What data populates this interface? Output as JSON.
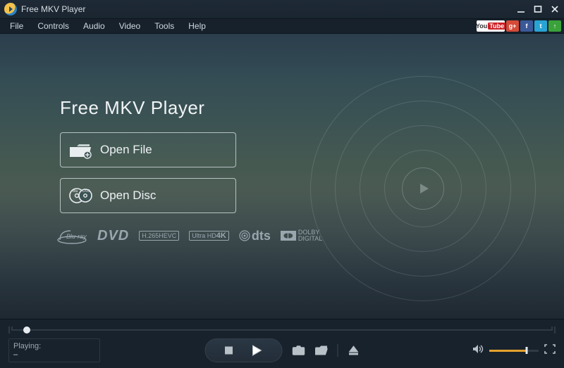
{
  "app": {
    "title": "Free MKV Player"
  },
  "menu": {
    "file": "File",
    "controls": "Controls",
    "audio": "Audio",
    "video": "Video",
    "tools": "Tools",
    "help": "Help"
  },
  "social": {
    "youtube": "You",
    "youtube_tube": "Tube",
    "gplus": "g+",
    "fb": "f",
    "tw": "t",
    "up": "↑"
  },
  "main": {
    "heading": "Free MKV Player",
    "open_file": "Open File",
    "open_disc": "Open Disc"
  },
  "formats": {
    "bluray": "Blu-ray",
    "dvd": "DVD",
    "h265_top": "H.265",
    "h265_bot": "HEVC",
    "uhd_top": "Ultra HD",
    "uhd_bot": "4K",
    "dts": "dts",
    "dolby_top": "DOLBY",
    "dolby_bot": "DIGITAL"
  },
  "status": {
    "label": "Playing:",
    "value": "–"
  },
  "volume": {
    "percent": 75
  }
}
